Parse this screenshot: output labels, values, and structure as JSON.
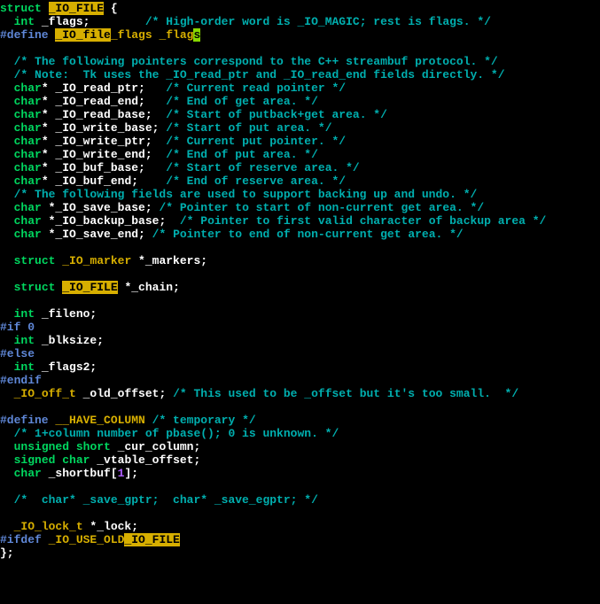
{
  "code": {
    "l01a": "struct",
    "l01b": "_IO_FILE",
    "l01c": " {",
    "l02a": "int",
    "l02b": " _flags;",
    "l02c": "/* High-order word is _IO_MAGIC; rest is flags. */",
    "l03a": "#define",
    "l03b": "_IO_file",
    "l03c": "_flags _flag",
    "l03d": "s",
    "l05": "/* The following pointers correspond to the C++ streambuf protocol. */",
    "l06": "/* Note:  Tk uses the _IO_read_ptr and _IO_read_end fields directly. */",
    "l07a": "char",
    "l07b": "* _IO_read_ptr;",
    "l07c": "/* Current read pointer */",
    "l08a": "char",
    "l08b": "* _IO_read_end;",
    "l08c": "/* End of get area. */",
    "l09a": "char",
    "l09b": "* _IO_read_base;",
    "l09c": "/* Start of putback+get area. */",
    "l10a": "char",
    "l10b": "* _IO_write_base;",
    "l10c": "/* Start of put area. */",
    "l11a": "char",
    "l11b": "* _IO_write_ptr;",
    "l11c": "/* Current put pointer. */",
    "l12a": "char",
    "l12b": "* _IO_write_end;",
    "l12c": "/* End of put area. */",
    "l13a": "char",
    "l13b": "* _IO_buf_base;",
    "l13c": "/* Start of reserve area. */",
    "l14a": "char",
    "l14b": "* _IO_buf_end;",
    "l14c": "/* End of reserve area. */",
    "l15": "/* The following fields are used to support backing up and undo. */",
    "l16a": "char",
    "l16b": " *_IO_save_base;",
    "l16c": "/* Pointer to start of non-current get area. */",
    "l17a": "char",
    "l17b": " *_IO_backup_base;",
    "l17c": "/* Pointer to first valid character of backup area */",
    "l18a": "char",
    "l18b": " *_IO_save_end;",
    "l18c": "/* Pointer to end of non-current get area. */",
    "l20a": "struct",
    "l20b": "_IO_marker",
    "l20c": " *_markers;",
    "l22a": "struct",
    "l22b": "_IO_FILE",
    "l22c": " *_chain;",
    "l24a": "int",
    "l24b": " _fileno;",
    "l25": "#if 0",
    "l26a": "int",
    "l26b": " _blksize;",
    "l27": "#else",
    "l28a": "int",
    "l28b": " _flags2;",
    "l29": "#endif",
    "l30a": "_IO_off_t",
    "l30b": " _old_offset;",
    "l30c": "/* This used to be _offset but it's too small.  */",
    "l32a": "#define",
    "l32b": "__HAVE_COLUMN",
    "l32c": "/* temporary */",
    "l33": "/* 1+column number of pbase(); 0 is unknown. */",
    "l34a": "unsigned",
    "l34a2": "short",
    "l34b": " _cur_column;",
    "l35a": "signed",
    "l35a2": "char",
    "l35b": " _vtable_offset;",
    "l36a": "char",
    "l36b": " _shortbuf[",
    "l36c": "1",
    "l36d": "];",
    "l38": "/*  char* _save_gptr;  char* _save_egptr; */",
    "l40a": "_IO_lock_t",
    "l40b": " *_lock;",
    "l41a": "#ifdef",
    "l41b": " _IO_USE_OLD",
    "l41c": "_IO_FILE",
    "l42": "};"
  }
}
